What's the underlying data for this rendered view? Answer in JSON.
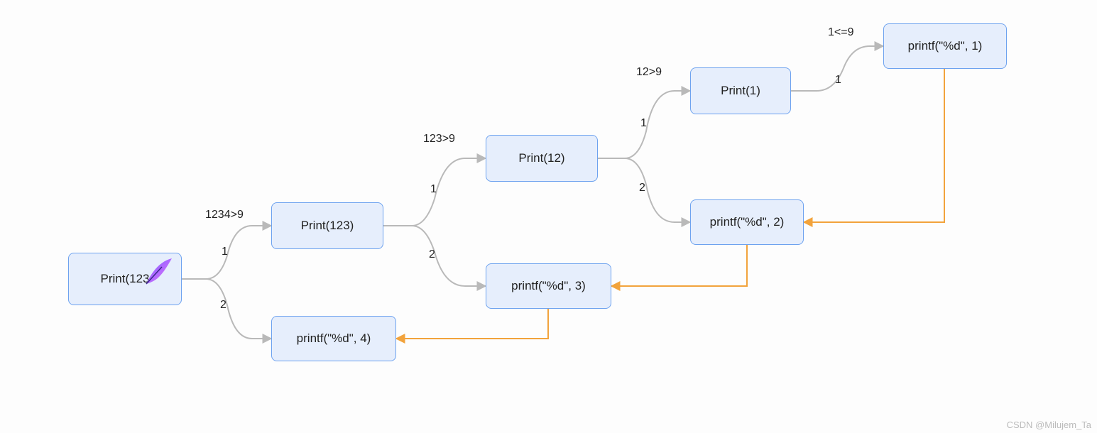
{
  "nodes": {
    "root": {
      "label": "Print(123"
    },
    "p123": {
      "label": "Print(123)"
    },
    "p12": {
      "label": "Print(12)"
    },
    "p1": {
      "label": "Print(1)"
    },
    "pf1": {
      "label": "printf(\"%d\", 1)"
    },
    "pf2": {
      "label": "printf(\"%d\", 2)"
    },
    "pf3": {
      "label": "printf(\"%d\", 3)"
    },
    "pf4": {
      "label": "printf(\"%d\", 4)"
    }
  },
  "edgeLabels": {
    "root_cond": "1234>9",
    "root_top": "1",
    "root_bot": "2",
    "p123_cond": "123>9",
    "p123_top": "1",
    "p123_bot": "2",
    "p12_cond": "12>9",
    "p12_top": "1",
    "p12_bot": "2",
    "p1_cond": "1<=9",
    "p1_top": "1"
  },
  "watermark": "CSDN @Milujem_Ta"
}
